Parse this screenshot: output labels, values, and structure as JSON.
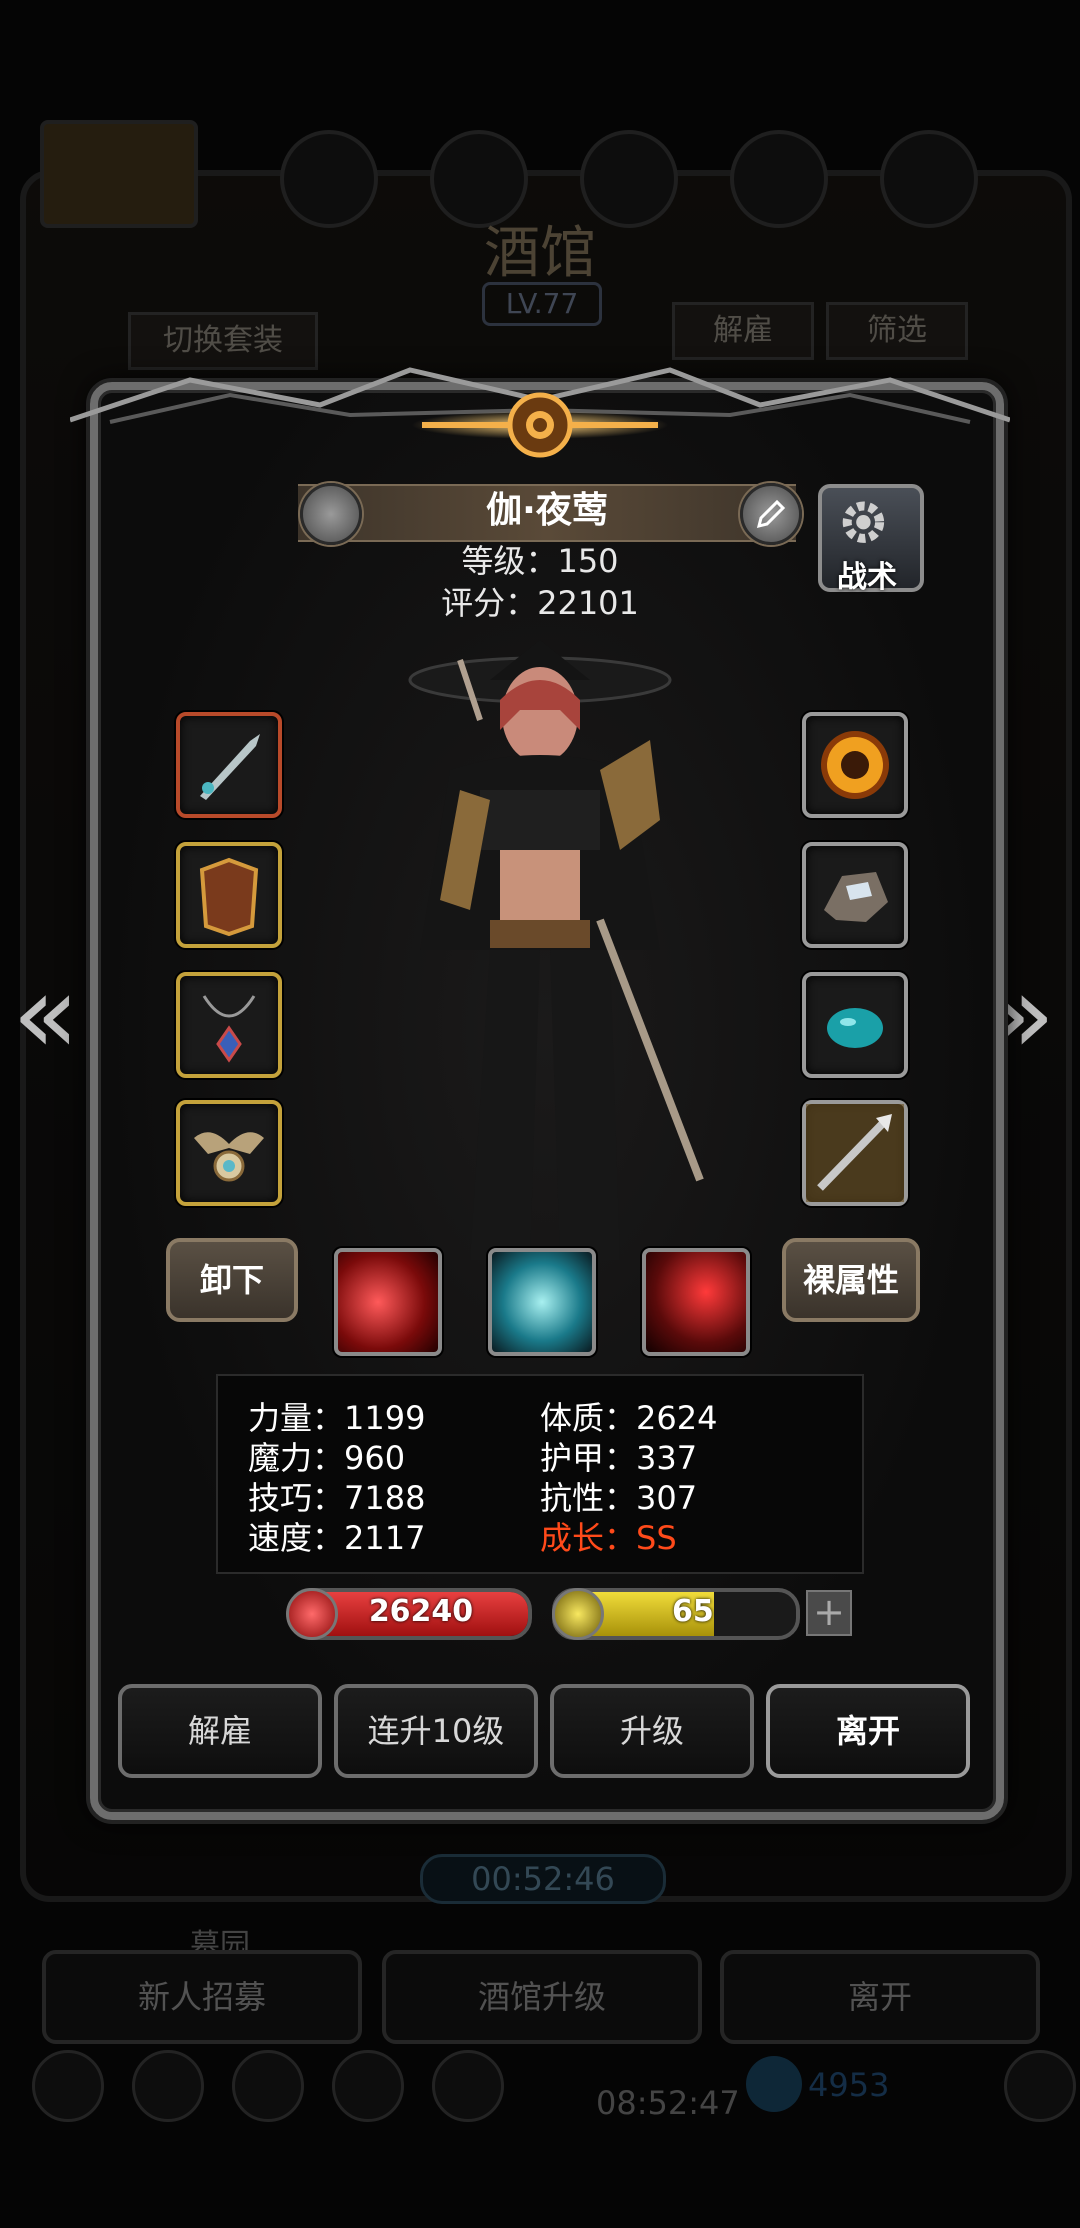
{
  "background": {
    "title": "酒馆",
    "level": "LV.77",
    "switch_outfit": "切换套装",
    "dismiss": "解雇",
    "filter": "筛选",
    "timer": "00:52:46",
    "section_label": "墓园",
    "bottom_buttons": [
      "新人招募",
      "酒馆升级",
      "离开"
    ],
    "clock": "08:52:47",
    "currency": "4953"
  },
  "hero": {
    "name": "伽·夜莺",
    "level_label": "等级：150",
    "score_label": "评分：22101",
    "tactics": "战术"
  },
  "equipment": {
    "left": [
      {
        "name": "weapon-dagger",
        "frame": "red"
      },
      {
        "name": "armor-chest",
        "frame": "gold"
      },
      {
        "name": "necklace",
        "frame": "gold"
      },
      {
        "name": "amulet-winged",
        "frame": "gold"
      }
    ],
    "right": [
      {
        "name": "ring-fire",
        "frame": "silver"
      },
      {
        "name": "ore-stone",
        "frame": "silver"
      },
      {
        "name": "gem-turquoise",
        "frame": "silver"
      },
      {
        "name": "spear-relic",
        "frame": "silver"
      }
    ]
  },
  "buttons": {
    "unequip": "卸下",
    "base_attributes": "裸属性"
  },
  "skills": [
    "red-slash-icon",
    "cyan-vortex-icon",
    "blood-blade-icon"
  ],
  "stats": {
    "left": [
      "力量：1199",
      "魔力：960",
      "技巧：7188",
      "速度：2117"
    ],
    "right": [
      "体质：2624",
      "护甲：337",
      "抗性：307"
    ],
    "growth": "成长：SS"
  },
  "bars": {
    "hp": "26240",
    "energy": "65",
    "energy_fraction": 0.66,
    "plus": "+"
  },
  "actions": [
    "解雇",
    "连升10级",
    "升级",
    "离开"
  ],
  "colors": {
    "hp_red": "#c81e1e",
    "energy_yellow": "#d9c21a",
    "growth_orange": "#ff4a1a",
    "frame_gold": "#c4a23b",
    "frame_red": "#b84a2a"
  }
}
